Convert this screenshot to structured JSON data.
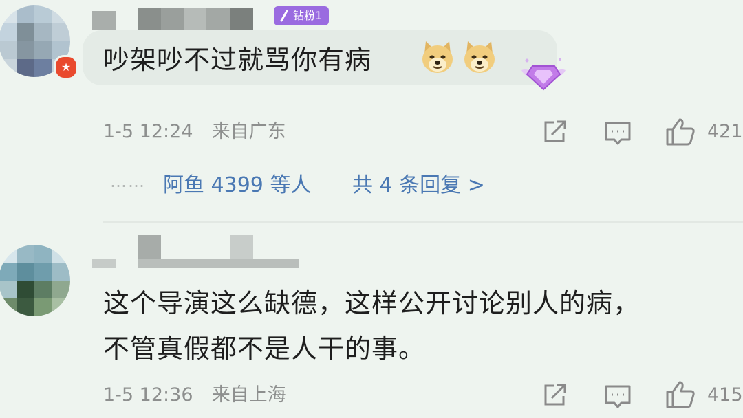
{
  "comments": [
    {
      "fan_badge": "钻粉1",
      "content": "吵架吵不过就骂你有病",
      "emoji": [
        "doge-emoji",
        "doge-emoji"
      ],
      "time": "1-5 12:24",
      "location": "来自广东",
      "likes": "421",
      "replies": {
        "dots": "……",
        "users": "阿鱼 4399 等人",
        "total": "共 4 条回复 >"
      }
    },
    {
      "content_line1": "这个导演这么缺德，这样公开讨论别人的病，",
      "content_line2": "不管真假都不是人干的事。",
      "time": "1-5 12:36",
      "location": "来自上海",
      "likes": "415"
    }
  ],
  "colors": {
    "background": "#eef4ef",
    "link": "#4a78b3",
    "fan_badge": "#9a6be0",
    "meta": "#8d8f8e"
  }
}
